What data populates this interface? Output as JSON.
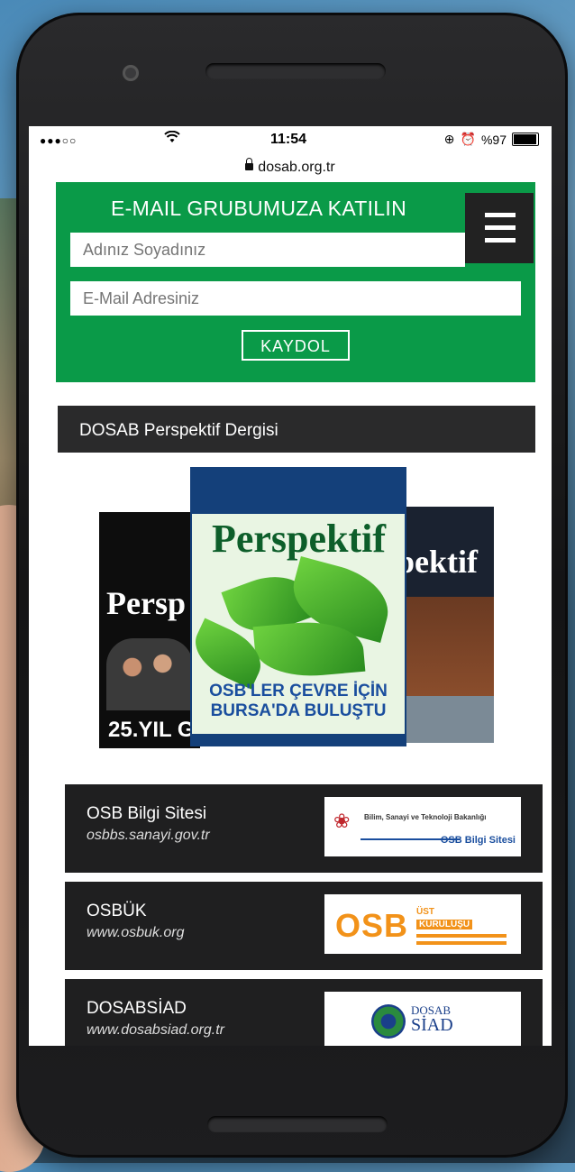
{
  "status_bar": {
    "signal": "●●●○○",
    "time": "11:54",
    "battery": "%97",
    "battery_level": 0.97,
    "icons": [
      "wifi-icon",
      "screen-rotation-lock-icon",
      "alarm-icon",
      "battery-icon"
    ]
  },
  "address_bar": {
    "url": "dosab.org.tr",
    "icon": "lock-icon"
  },
  "newsletter": {
    "title": "E-MAIL GRUBUMUZA KATILIN",
    "name_placeholder": "Adınız Soyadınız",
    "email_placeholder": "E-Mail Adresiniz",
    "submit_label": "KAYDOL",
    "background_color": "#0a9a48"
  },
  "menu": {
    "icon": "hamburger-menu-icon"
  },
  "magazine_section": {
    "title": "DOSAB Perspektif Dergisi",
    "covers": [
      {
        "logo": "Persp",
        "headline": "25.YIL G"
      },
      {
        "logo": "Perspektif",
        "headline_line1": "OSB'LER ÇEVRE İÇİN",
        "headline_line2": "BURSA'DA BULUŞTU"
      },
      {
        "logo": "pektif"
      }
    ]
  },
  "links": [
    {
      "name": "OSB Bilgi Sitesi",
      "url": "osbbs.sanayi.gov.tr",
      "logo_small": "Bilim, Sanayi ve Teknoloji Bakanlığı",
      "logo_label": "OSB Bilgi Sitesi"
    },
    {
      "name": "OSBÜK",
      "url": "www.osbuk.org",
      "logo_main": "OSB",
      "logo_ust": "ÜST",
      "logo_kurulusu": "KURULUŞU"
    },
    {
      "name": "DOSABSİAD",
      "url": "www.dosabsiad.org.tr",
      "logo_line1": "DOSAB",
      "logo_line2": "SİAD"
    }
  ]
}
